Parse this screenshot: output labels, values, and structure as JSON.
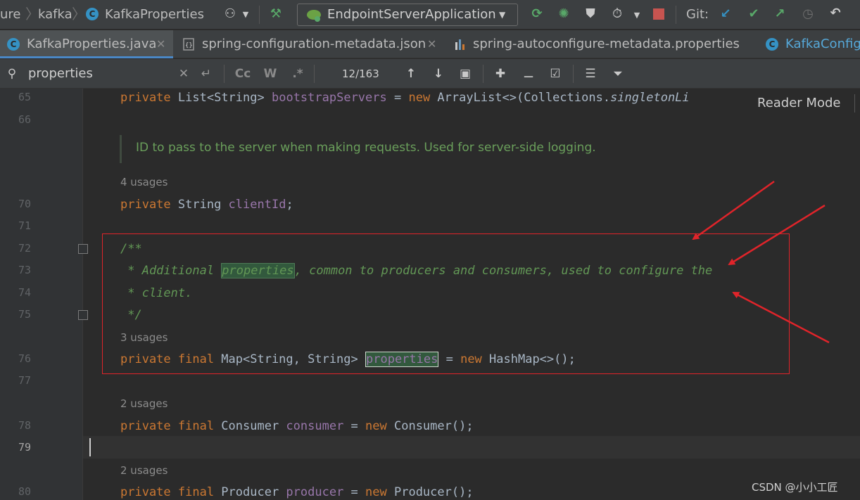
{
  "breadcrumbs": [
    "ure",
    "kafka",
    "KafkaProperties"
  ],
  "toolbar": {
    "run_config": "EndpointServerApplication",
    "git_label": "Git:"
  },
  "tabs": [
    {
      "label": "KafkaProperties.java",
      "icon": "java-class-icon",
      "active": true
    },
    {
      "label": "spring-configuration-metadata.json",
      "icon": "json-file-icon"
    },
    {
      "label": "spring-autoconfigure-metadata.properties",
      "icon": "properties-file-icon"
    },
    {
      "label": "KafkaConfig.",
      "icon": "java-class-icon"
    }
  ],
  "find": {
    "query": "properties",
    "option_case": "Cc",
    "option_words": "W",
    "option_regex": ".*",
    "match_count": "12/163"
  },
  "editor": {
    "reader_mode": "Reader Mode",
    "rendered_doc": "ID to pass to the server when making requests. Used for server-side logging.",
    "line_numbers": [
      "65",
      "66",
      "70",
      "71",
      "72",
      "73",
      "74",
      "75",
      "76",
      "77",
      "78",
      "79",
      "80"
    ],
    "current_line": "79",
    "usages": [
      "4 usages",
      "3 usages",
      "2 usages",
      "2 usages"
    ],
    "line65": {
      "kw": "private",
      "type": "List<String>",
      "field": "bootstrapServers",
      "rest": " = ",
      "kw2": "new",
      "rest2": " ArrayList<>(Collections.",
      "it": "singletonLi"
    },
    "line70": {
      "kw": "private",
      "type": " String ",
      "field": "clientId",
      "rest": ";"
    },
    "line72": "/**",
    "line73": {
      "a": " * Additional ",
      "hl": "properties",
      "b": ", common to producers and consumers, used to configure the"
    },
    "line74": " * client.",
    "line75": " */",
    "line76": {
      "kw": "private final",
      "type": " Map<String, String> ",
      "field": "properties",
      "rest": " = ",
      "kw2": "new",
      "rest2": " HashMap<>();"
    },
    "line78": {
      "kw": "private final",
      "type": " Consumer ",
      "field": "consumer",
      "rest": " = ",
      "kw2": "new",
      "rest2": " Consumer();"
    },
    "line80": {
      "kw": "private final",
      "type": " Producer ",
      "field": "producer",
      "rest": " = ",
      "kw2": "new",
      "rest2": " Producer();"
    }
  },
  "watermark": "CSDN @小小工匠",
  "colors": {
    "keyword": "#cc7832",
    "field": "#9876aa",
    "doc_comment": "#629755",
    "annotation_red": "#e0242a",
    "search_highlight": "#32593d"
  }
}
